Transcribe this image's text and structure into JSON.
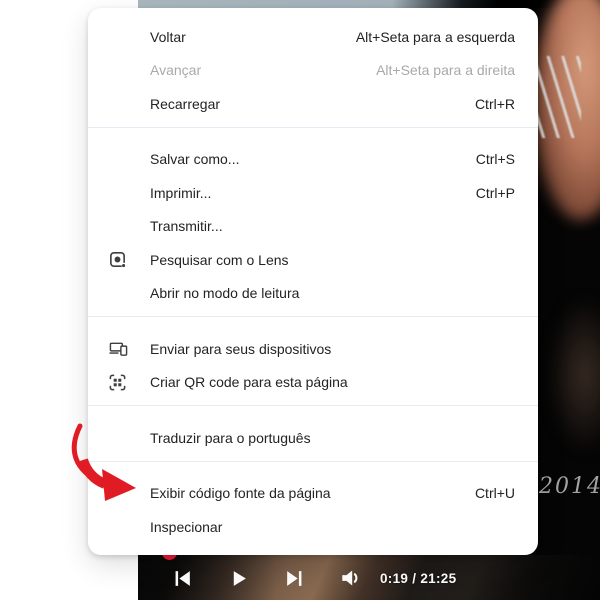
{
  "menu": {
    "items": [
      {
        "label": "Voltar",
        "shortcut": "Alt+Seta para a esquerda"
      },
      {
        "label": "Avançar",
        "shortcut": "Alt+Seta para a direita",
        "disabled": true
      },
      {
        "label": "Recarregar",
        "shortcut": "Ctrl+R"
      },
      {
        "label": "Salvar como...",
        "shortcut": "Ctrl+S"
      },
      {
        "label": "Imprimir...",
        "shortcut": "Ctrl+P"
      },
      {
        "label": "Transmitir..."
      },
      {
        "label": "Pesquisar com o Lens",
        "icon": "lens-icon"
      },
      {
        "label": "Abrir no modo de leitura"
      },
      {
        "label": "Enviar para seus dispositivos",
        "icon": "send-to-devices-icon"
      },
      {
        "label": "Criar QR code para esta página",
        "icon": "qr-code-icon"
      },
      {
        "label": "Traduzir para o português"
      },
      {
        "label": "Exibir código fonte da página",
        "shortcut": "Ctrl+U"
      },
      {
        "label": "Inspecionar"
      }
    ]
  },
  "player": {
    "time": "0:19 / 21:25",
    "buttons": [
      "previous-icon",
      "play-icon",
      "next-icon",
      "volume-icon"
    ]
  },
  "video": {
    "year_caption": "2014"
  },
  "annotation": {
    "type": "red-curved-arrow",
    "points_to": "Exibir código fonte da página",
    "color": "#e01b24"
  },
  "colors": {
    "menu_background": "#ffffff",
    "menu_text": "#232323",
    "menu_disabled_text": "#a9a9a9",
    "separator": "#e4ebf3",
    "scrubber_red": "#f51937",
    "arrow_red": "#e01b24",
    "player_text": "#ffffff"
  }
}
